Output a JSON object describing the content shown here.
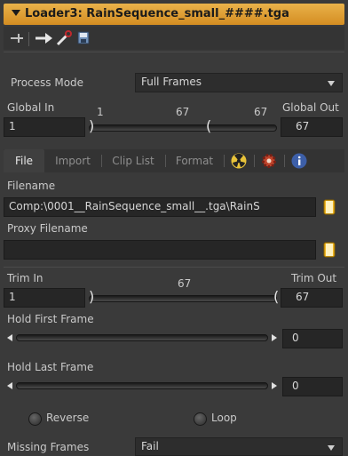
{
  "header": {
    "title": "Loader3: RainSequence_small_####.tga"
  },
  "process_mode": {
    "label": "Process Mode",
    "value": "Full Frames"
  },
  "global": {
    "in_label": "Global In",
    "out_label": "Global Out",
    "in_value": "1",
    "out_value": "67",
    "tick_left": "1",
    "tick_mid": "67",
    "tick_right": "67"
  },
  "tabs": {
    "file": "File",
    "import": "Import",
    "clip_list": "Clip List",
    "format": "Format"
  },
  "file": {
    "filename_label": "Filename",
    "filename_value": "Comp:\\0001__RainSequence_small__.tga\\RainS",
    "proxy_label": "Proxy Filename",
    "proxy_value": ""
  },
  "trim": {
    "in_label": "Trim In",
    "out_label": "Trim Out",
    "in_value": "1",
    "out_value": "67",
    "mid_tick": "67"
  },
  "hold_first": {
    "label": "Hold First Frame",
    "value": "0"
  },
  "hold_last": {
    "label": "Hold Last Frame",
    "value": "0"
  },
  "options": {
    "reverse": "Reverse",
    "loop": "Loop"
  },
  "missing_frames": {
    "label": "Missing Frames",
    "value": "Fail"
  },
  "colors": {
    "title_bar": "#e0a03a",
    "panel_bg": "#3a3a3a",
    "field_bg": "#262626"
  },
  "icons": [
    "collapse-arrow-icon",
    "pin-icon",
    "arrow-right-icon",
    "wrench-icon",
    "save-icon",
    "radiation-icon",
    "settings-gear-icon",
    "info-icon",
    "folder-browse-icon"
  ]
}
